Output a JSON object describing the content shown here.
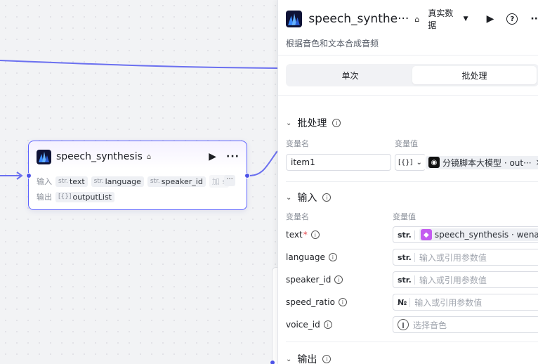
{
  "node": {
    "title": "speech_synthesis",
    "input_label": "输入",
    "output_label": "输出",
    "inputs": [
      {
        "type": "str.",
        "name": "text"
      },
      {
        "type": "str.",
        "name": "language"
      },
      {
        "type": "str.",
        "name": "speaker_id"
      },
      {
        "type": "",
        "name": "加 s"
      }
    ],
    "more": "···",
    "outputs": [
      {
        "type": "[{}]",
        "name": "outputList"
      }
    ]
  },
  "panel": {
    "title": "speech_synthe···",
    "data_mode": "真实数据",
    "description": "根据音色和文本合成音频",
    "tabs": [
      {
        "label": "单次",
        "active": false
      },
      {
        "label": "批处理",
        "active": true
      }
    ],
    "batch": {
      "title": "批处理",
      "col_name": "变量名",
      "col_value": "变量值",
      "var_name": "item1",
      "type_badge": "[{}]",
      "ref_label": "分镜脚本大模型 · out···",
      "clear": "×"
    },
    "inputs": {
      "title": "输入",
      "col_name": "变量名",
      "col_value": "变量值",
      "rows": [
        {
          "name": "text",
          "required": true,
          "type": "str.",
          "ref": "speech_synthesis · wenan",
          "placeholder": ""
        },
        {
          "name": "language",
          "required": false,
          "type": "str.",
          "ref": "",
          "placeholder": "输入或引用参数值"
        },
        {
          "name": "speaker_id",
          "required": false,
          "type": "str.",
          "ref": "",
          "placeholder": "输入或引用参数值"
        },
        {
          "name": "speed_ratio",
          "required": false,
          "type": "№",
          "ref": "",
          "placeholder": "输入或引用参数值"
        },
        {
          "name": "voice_id",
          "required": false,
          "type": "voice",
          "ref": "",
          "placeholder": "选择音色"
        }
      ]
    },
    "output": {
      "title": "输出"
    }
  },
  "colors": {
    "accent": "#4d53e8",
    "node_border": "#5c62ff",
    "logo_bg": "#0e1236"
  }
}
